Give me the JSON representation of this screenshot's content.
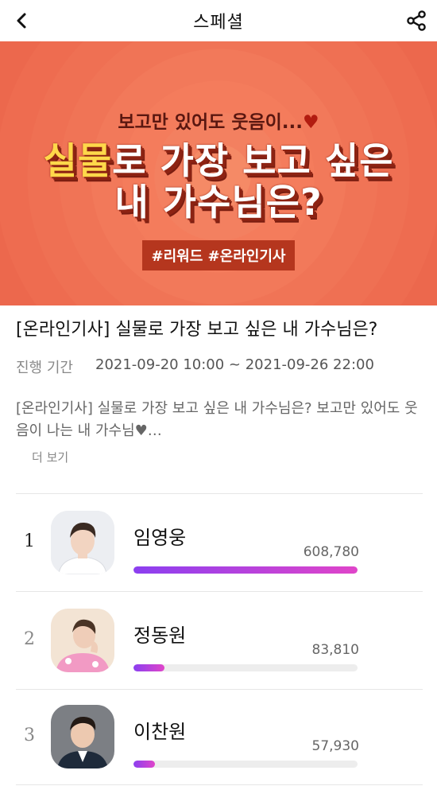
{
  "header": {
    "title": "스페셜",
    "back_icon": "chevron-left-icon",
    "share_icon": "share-icon"
  },
  "banner": {
    "subtitle": "보고만 있어도 웃음이...",
    "heart": "♥",
    "line1_highlight": "실물",
    "line1_rest": "로 가장 보고 싶은",
    "line2": "내 가수님은?",
    "tags": "#리워드 #온라인기사",
    "colors": {
      "background": "#f07456",
      "highlight": "#ffd84a",
      "tag_bg": "#b5361e"
    }
  },
  "event": {
    "title": "[온라인기사] 실물로 가장 보고 싶은 내 가수님은?",
    "period_label": "진행 기간",
    "period_value": "2021-09-20 10:00 ~ 2021-09-26 22:00",
    "description": "[온라인기사] 실물로 가장 보고 싶은 내 가수님은? 보고만 있어도 웃음이 나는 내 가수님♥…",
    "more_label": "더 보기"
  },
  "ranking": [
    {
      "rank": "1",
      "name": "임영웅",
      "votes": "608,780",
      "fill": 1.0
    },
    {
      "rank": "2",
      "name": "정동원",
      "votes": "83,810",
      "fill": 0.138
    },
    {
      "rank": "3",
      "name": "이찬원",
      "votes": "57,930",
      "fill": 0.095
    }
  ],
  "colors": {
    "bar_start": "#8b3ff0",
    "bar_end": "#e045c9"
  }
}
